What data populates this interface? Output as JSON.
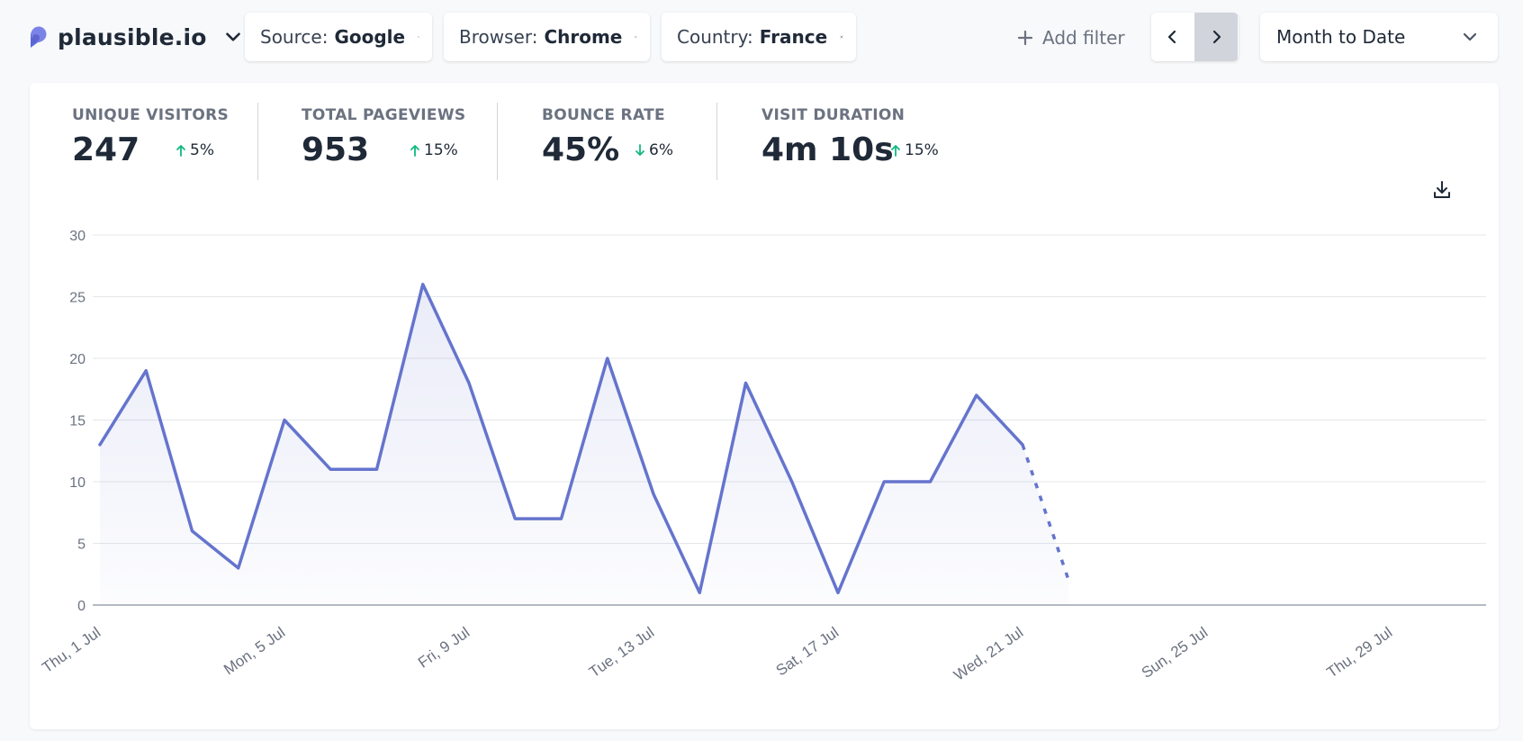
{
  "topbar": {
    "site_name": "plausible.io",
    "filters": [
      {
        "label": "Source:",
        "value": "Google"
      },
      {
        "label": "Browser:",
        "value": "Chrome"
      },
      {
        "label": "Country:",
        "value": "France"
      }
    ],
    "add_filter_label": "Add filter",
    "period_label": "Month to Date"
  },
  "stats": [
    {
      "label": "UNIQUE VISITORS",
      "value": "247",
      "change": "5%",
      "direction": "up"
    },
    {
      "label": "TOTAL PAGEVIEWS",
      "value": "953",
      "change": "15%",
      "direction": "up"
    },
    {
      "label": "BOUNCE RATE",
      "value": "45%",
      "change": "6%",
      "direction": "down"
    },
    {
      "label": "VISIT DURATION",
      "value": "4m 10s",
      "change": "15%",
      "direction": "up"
    }
  ],
  "colors": {
    "line": "#6574cd",
    "up_arrow": "#10b981",
    "down_arrow": "#10b981",
    "grid": "#e5e7eb",
    "axis_text": "#6b7280"
  },
  "chart_data": {
    "type": "line",
    "x": [
      "Thu, 1 Jul",
      "Fri, 2 Jul",
      "Sat, 3 Jul",
      "Sun, 4 Jul",
      "Mon, 5 Jul",
      "Tue, 6 Jul",
      "Wed, 7 Jul",
      "Thu, 8 Jul",
      "Fri, 9 Jul",
      "Sat, 10 Jul",
      "Sun, 11 Jul",
      "Mon, 12 Jul",
      "Tue, 13 Jul",
      "Wed, 14 Jul",
      "Thu, 15 Jul",
      "Fri, 16 Jul",
      "Sat, 17 Jul",
      "Sun, 18 Jul",
      "Mon, 19 Jul",
      "Tue, 20 Jul",
      "Wed, 21 Jul",
      "Thu, 22 Jul",
      "Fri, 23 Jul",
      "Sat, 24 Jul",
      "Sun, 25 Jul",
      "Mon, 26 Jul",
      "Tue, 27 Jul",
      "Wed, 28 Jul",
      "Thu, 29 Jul",
      "Fri, 30 Jul",
      "Sat, 31 Jul"
    ],
    "series": [
      {
        "values": [
          13,
          19,
          6,
          3,
          15,
          11,
          11,
          26,
          18,
          7,
          7,
          20,
          9,
          1,
          18,
          10,
          1,
          10,
          10,
          17,
          13,
          2
        ]
      }
    ],
    "dashed_from_index": 20,
    "tick_labels": [
      "Thu, 1 Jul",
      "Mon, 5 Jul",
      "Fri, 9 Jul",
      "Tue, 13 Jul",
      "Sat, 17 Jul",
      "Wed, 21 Jul",
      "Sun, 25 Jul",
      "Thu, 29 Jul"
    ],
    "ylim": [
      0,
      30
    ],
    "yticks": [
      0,
      5,
      10,
      15,
      20,
      25,
      30
    ],
    "grid": true
  }
}
